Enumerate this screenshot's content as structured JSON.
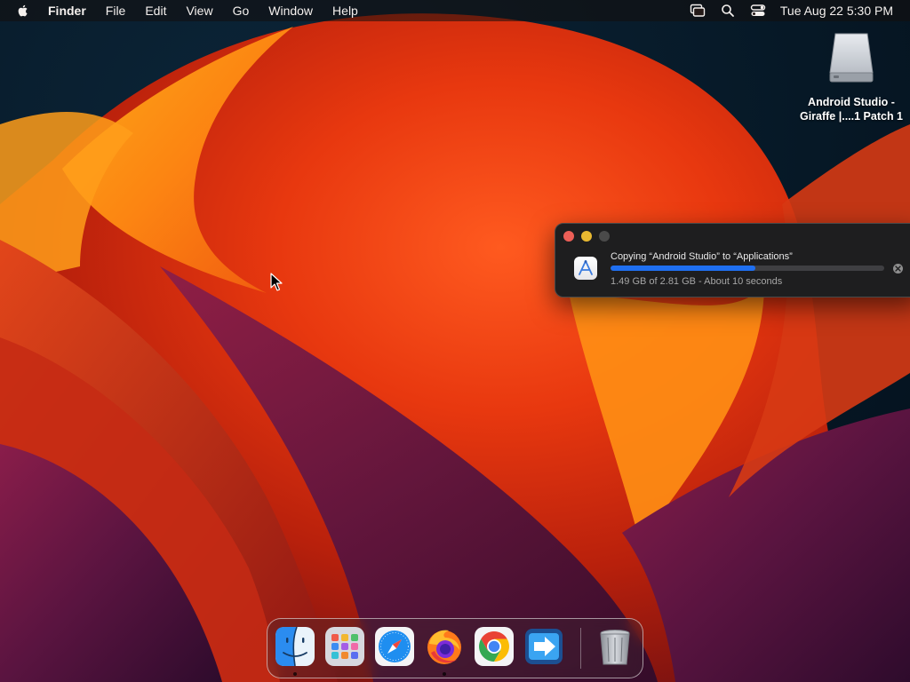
{
  "menubar": {
    "app_name": "Finder",
    "items": [
      "File",
      "Edit",
      "View",
      "Go",
      "Window",
      "Help"
    ],
    "clock": "Tue Aug 22  5:30 PM",
    "status_icons": [
      "screen-mirroring-icon",
      "spotlight-search-icon",
      "control-center-icon"
    ]
  },
  "desktop": {
    "disk_label": "Android Studio - Giraffe |....1 Patch 1"
  },
  "copy_dialog": {
    "title": "Copying “Android Studio” to “Applications”",
    "status": "1.49 GB of 2.81 GB - About 10 seconds",
    "progress_fraction": 0.53
  },
  "dock": {
    "items": [
      "Finder",
      "Launchpad",
      "Safari",
      "Firefox",
      "Google Chrome",
      "Migration Assistant",
      "Trash"
    ]
  },
  "colors": {
    "progress": "#1f6ff0",
    "close": "#ec5f57",
    "minimize": "#e9b931"
  }
}
